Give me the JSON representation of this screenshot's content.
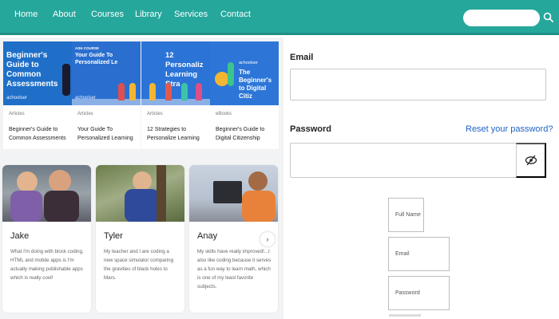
{
  "nav": {
    "links": [
      "Home",
      "About",
      "Courses",
      "Library",
      "Services",
      "Contact"
    ],
    "search_placeholder": ""
  },
  "articles": [
    {
      "thumb_title": "Beginner's Guide to Common Assessments",
      "brand": "achoolser",
      "type": "Articles",
      "title": "Beginner's Guide to Common Assessments"
    },
    {
      "thumb_kicker": "ASH COURSE",
      "thumb_title": "Your Guide To Personalized Le",
      "brand": "achoolser",
      "type": "Articles",
      "title": "Your Guide To Personalized Learning"
    },
    {
      "thumb_title": "12 Personaliz Learning Stra",
      "brand": "",
      "type": "Articles",
      "title": "12 Strategies to Personalize Learning"
    },
    {
      "thumb_brand": "achoolser",
      "thumb_title": "The Beginner's to Digital Citiz",
      "type": "eBooks",
      "title": "Beginner's Guide to Digital Citizenship"
    }
  ],
  "students": [
    {
      "name": "Jake",
      "quote": "What I'm doing with block coding, HTML and mobile apps is I'm actually making publishable apps which is really cool!"
    },
    {
      "name": "Tyler",
      "quote": "My teacher and I are coding a new space simulator comparing the gravities of black holes to Mars."
    },
    {
      "name": "Anay",
      "quote": "My skills have really improved!...I also like coding because it serves as a fun way to learn math, which is one of my least favorite subjects."
    }
  ],
  "carousel": {
    "next_glyph": "›"
  },
  "login": {
    "email_label": "Email",
    "password_label": "Password",
    "reset_link": "Reset your password?"
  },
  "signup": {
    "full_name": "Full Name",
    "email": "Email",
    "password": "Password"
  },
  "colors": {
    "nav_bg": "#26a79c",
    "link_blue": "#1f63c8",
    "thumb_blue": "#1f6fc8"
  }
}
